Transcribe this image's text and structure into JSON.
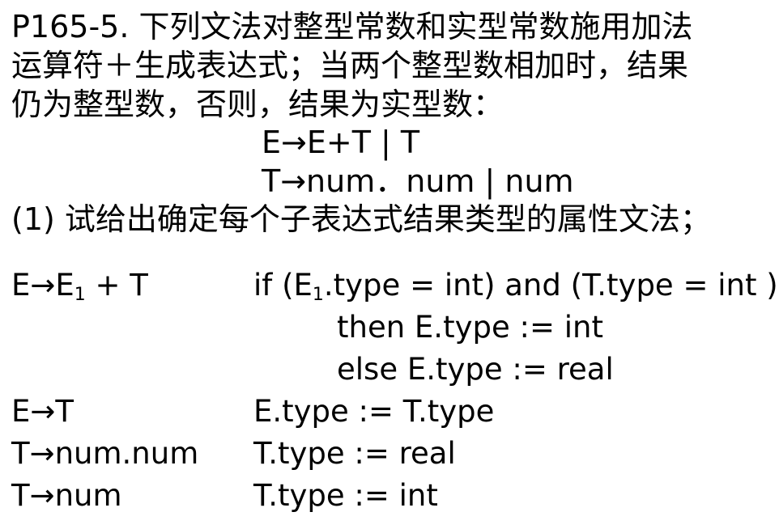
{
  "problem": {
    "line1": "P165-5. 下列文法对整型常数和实型常数施用加法",
    "line2": "运算符＋生成表达式；当两个整型数相加时，结果",
    "line3": "仍为整型数，否则，结果为实型数："
  },
  "grammar": {
    "prod1": "E→E+T | T",
    "prod2": "T→num．num | num"
  },
  "question": "(1) 试给出确定每个子表达式结果类型的属性文法；",
  "rules": [
    {
      "lhs_pre": "E→E",
      "lhs_sub": "1",
      "lhs_post": " + T",
      "action_pre": "if (E",
      "action_sub": "1",
      "action_post": ".type = int) and (T.type = int )",
      "then": "then E.type := int",
      "else": "else E.type := real"
    },
    {
      "lhs": "E→T",
      "action": "E.type := T.type"
    },
    {
      "lhs": "T→num.num",
      "action": "T.type := real"
    },
    {
      "lhs": "T→num",
      "action": "T.type := int"
    }
  ]
}
